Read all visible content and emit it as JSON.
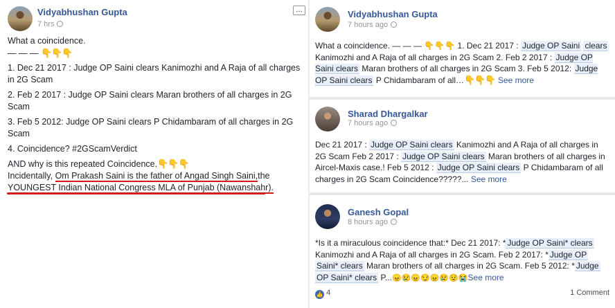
{
  "main_post": {
    "author": "Vidyabhushan Gupta",
    "time": "7 hrs",
    "more_icon": "...",
    "line1": "What a coincidence.",
    "line2_dashes": "— — —",
    "emoji_down": "👇👇👇",
    "item1": "1. Dec 21 2017 : Judge OP Saini clears Kanimozhi and A Raja of all charges in 2G Scam",
    "item2": "2. Feb 2 2017 : Judge OP Saini clears Maran brothers of all charges in 2G Scam",
    "item3": "3. Feb 5 2012: Judge OP Saini clears P Chidambaram of all charges in 2G Scam",
    "item4": "4. Coincidence? #2GScamVerdict",
    "why": "AND why is this repeated Coincidence.",
    "inc_prefix": "Incidentally, ",
    "inc_highlight": "Om Prakash Saini is the father of Angad Singh Saini,",
    "inc_suffix": "the",
    "inc_line2": "YOUNGEST Indian National Congress MLA of Punjab (Nawanshahr)."
  },
  "comments": [
    {
      "author": "Vidyabhushan Gupta",
      "time": "7 hours ago",
      "parts": {
        "a": "What a coincidence. — — — 👇👇👇 1. Dec 21 2017 : ",
        "h1": "Judge OP Saini",
        "b": "",
        "h1b": "clears",
        "c": " Kanimozhi and A Raja of all charges in 2G Scam 2. Feb 2 2017 : ",
        "h2": "Judge OP Saini clears",
        "d": " Maran brothers of all charges in 2G Scam 3. Feb 5 2012: ",
        "h3": "Judge OP Saini clears",
        "e": " P Chidambaram of all…",
        "emoji": "👇👇👇",
        "see_more": "See more"
      }
    },
    {
      "author": "Sharad Dhargalkar",
      "time": "7 hours ago",
      "parts": {
        "a": "Dec 21 2017 : ",
        "h1": "Judge OP Saini clears",
        "b": " Kanimozhi and A Raja of all charges in 2G Scam Feb 2 2017 : ",
        "h2": "Judge OP Saini clears",
        "c": " Maran brothers of all charges in Aircel-Maxis case.! Feb 5 2012 : ",
        "h3": "Judge OP Saini clears",
        "d": " P Chidambaram of all charges in 2G Scam Coincidence?????...",
        "see_more": "See more"
      }
    },
    {
      "author": "Ganesh Gopal",
      "time": "8 hours ago",
      "parts": {
        "a": "*Is it a miraculous coincidence that:* Dec 21 2017: *",
        "h1": "Judge OP Saini* clears",
        "b": " Kanimozhi and A Raja of all charges in 2G Scam. Feb 2 2017: *",
        "h2a": "Judge OP",
        "h2b": "Saini* clears",
        "c": " Maran brothers of all charges in 2G Scam. Feb 5 2012: *",
        "h3a": "Judge",
        "h3b": "OP Saini* clears",
        "d": " P...",
        "emoji": "😠😢😠😏😠😢😟😭",
        "see_more": "See more"
      },
      "likes": "4",
      "comments_count": "1 Comment"
    }
  ],
  "colors": {
    "link": "#365899",
    "annotation_red": "#d21a1a",
    "highlight_bg": "#e8eefa",
    "like_blue": "#4267b2"
  },
  "icons": [
    "globe-icon",
    "more-options-icon",
    "like-icon"
  ]
}
